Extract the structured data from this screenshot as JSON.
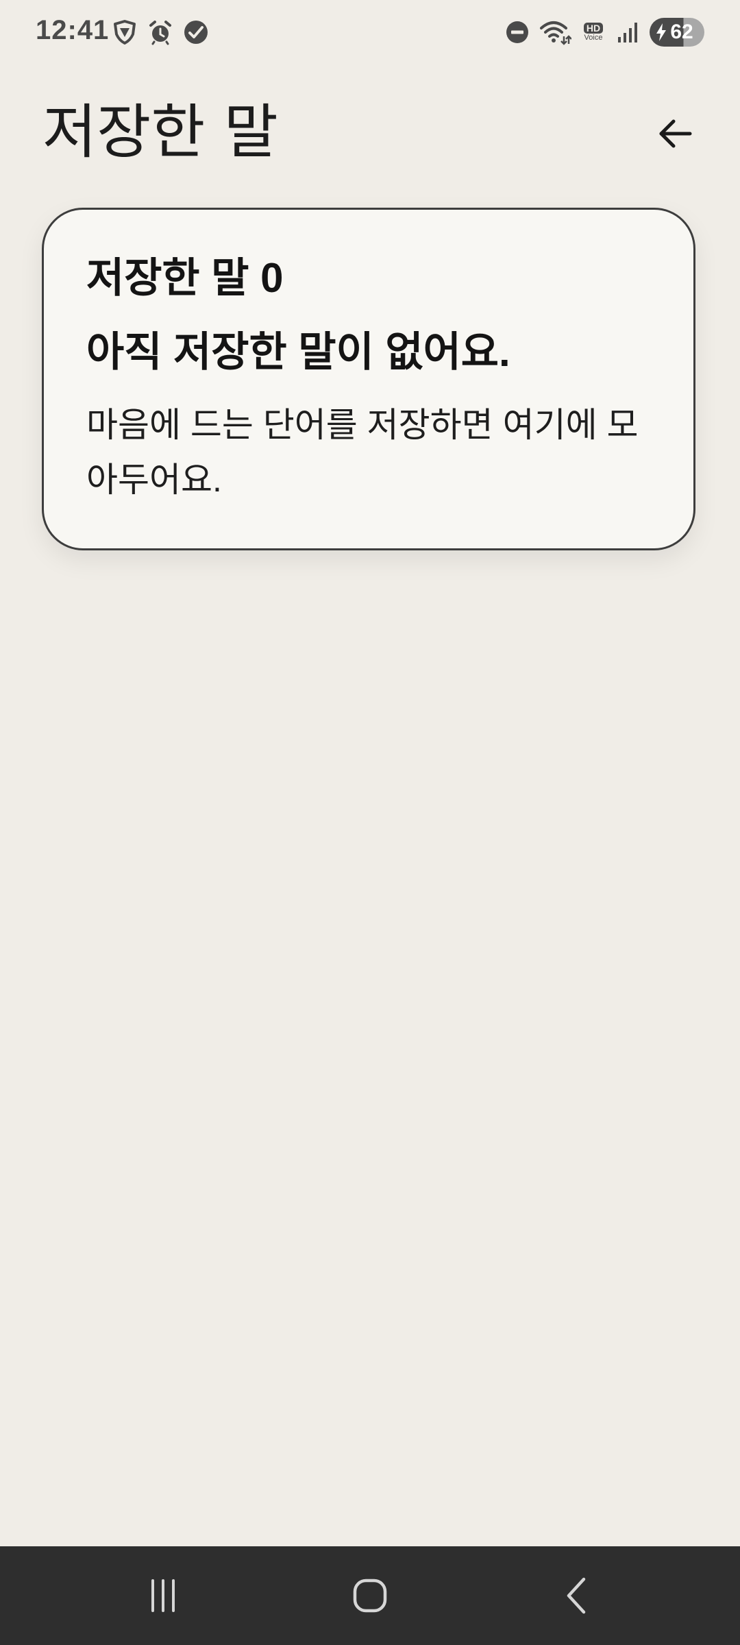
{
  "status_bar": {
    "time": "12:41",
    "left_icons": [
      "shield-icon",
      "alarm-icon",
      "check-circle-icon"
    ],
    "right_icons": [
      "do-not-disturb-icon",
      "wifi-icon",
      "hd-voice-icon",
      "signal-icon"
    ],
    "hd_voice_top": "HD",
    "hd_voice_bottom": "Voice",
    "battery_level": "62"
  },
  "header": {
    "title": "저장한 말",
    "back_icon": "arrow-left-icon"
  },
  "empty_state": {
    "count_label": "저장한 말 0",
    "heading": "아직 저장한 말이 없어요.",
    "body": "마음에 드는 단어를 저장하면 여기에 모아두어요."
  },
  "nav_bar": {
    "icons": [
      "recents-icon",
      "home-icon",
      "back-icon"
    ]
  },
  "colors": {
    "background": "#f0ede7",
    "card_background": "#f8f7f3",
    "card_border": "#3d3d3d",
    "nav_bar": "#2e2e2e",
    "text": "#141414"
  }
}
